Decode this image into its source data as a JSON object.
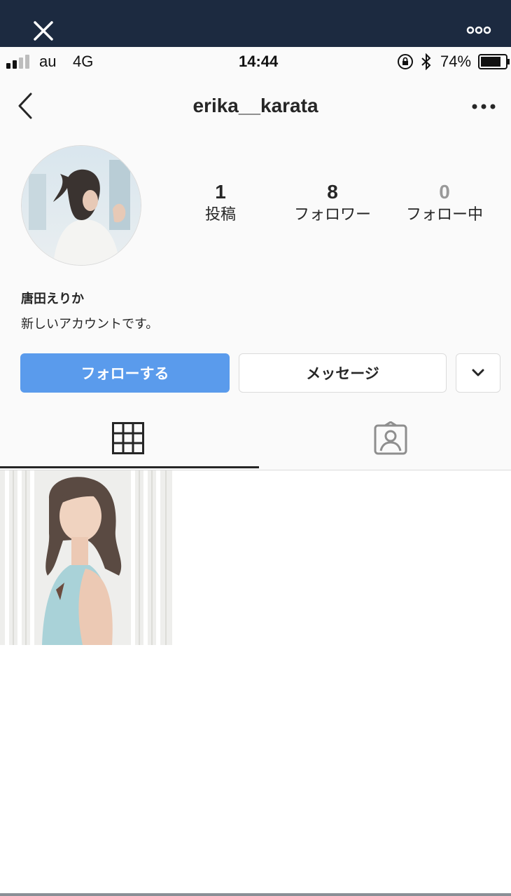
{
  "status_bar": {
    "carrier": "au",
    "network": "4G",
    "time": "14:44",
    "battery": "74%"
  },
  "nav": {
    "username": "erika__karata"
  },
  "profile": {
    "stats": [
      {
        "value": "1",
        "label": "投稿"
      },
      {
        "value": "8",
        "label": "フォロワー"
      },
      {
        "value": "0",
        "label": "フォロー中"
      }
    ],
    "display_name": "唐田えりか",
    "bio": "新しいアカウントです。"
  },
  "buttons": {
    "follow": "フォローする",
    "message": "メッセージ"
  },
  "icons": [
    "close-icon",
    "more-icon",
    "back-icon",
    "grid-icon",
    "tagged-icon",
    "chevron-down-icon"
  ],
  "colors": {
    "accent": "#5a9bec",
    "header": "#1c2a40",
    "following_count": "#999999"
  }
}
